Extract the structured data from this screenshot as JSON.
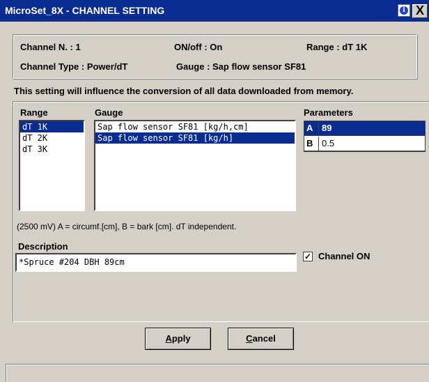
{
  "window": {
    "title": "MicroSet_8X - CHANNEL SETTING",
    "info_label": "i",
    "close_label": "X"
  },
  "channel_info": {
    "channel_number": "Channel N. : 1",
    "on_off": "ON/off : On",
    "range": "Range : dT 1K",
    "channel_type": "Channel Type : Power/dT",
    "gauge": "Gauge : Sap flow sensor SF81"
  },
  "notice": "This setting will influence the conversion of all data downloaded from memory.",
  "range_section": {
    "label": "Range",
    "items": [
      "dT 1K",
      "dT 2K",
      "dT 3K"
    ],
    "selected": "dT 1K"
  },
  "gauge_section": {
    "label": "Gauge",
    "items": [
      "Sap flow sensor SF81 [kg/h,cm]",
      "Sap flow sensor SF81 [kg/h]"
    ],
    "selected": "Sap flow sensor SF81 [kg/h]"
  },
  "parameters": {
    "label": "Parameters",
    "rows": [
      {
        "key": "A",
        "value": "89",
        "selected": true
      },
      {
        "key": "B",
        "value": "0.5",
        "selected": false
      }
    ]
  },
  "hint": "(2500 mV)  A = circumf.[cm], B = bark [cm]. dT independent.",
  "description": {
    "label": "Description",
    "value": "*Spruce #204 DBH 89cm"
  },
  "channel_on": {
    "label": "Channel ON",
    "checked": true,
    "check_mark": "✓"
  },
  "buttons": {
    "apply_first": "A",
    "apply_rest": "pply",
    "cancel_first": "C",
    "cancel_rest": "ancel"
  },
  "colors": {
    "titlebar": "#0a2b8f",
    "selection": "#0a2b8f",
    "face": "#d4d0c8"
  }
}
